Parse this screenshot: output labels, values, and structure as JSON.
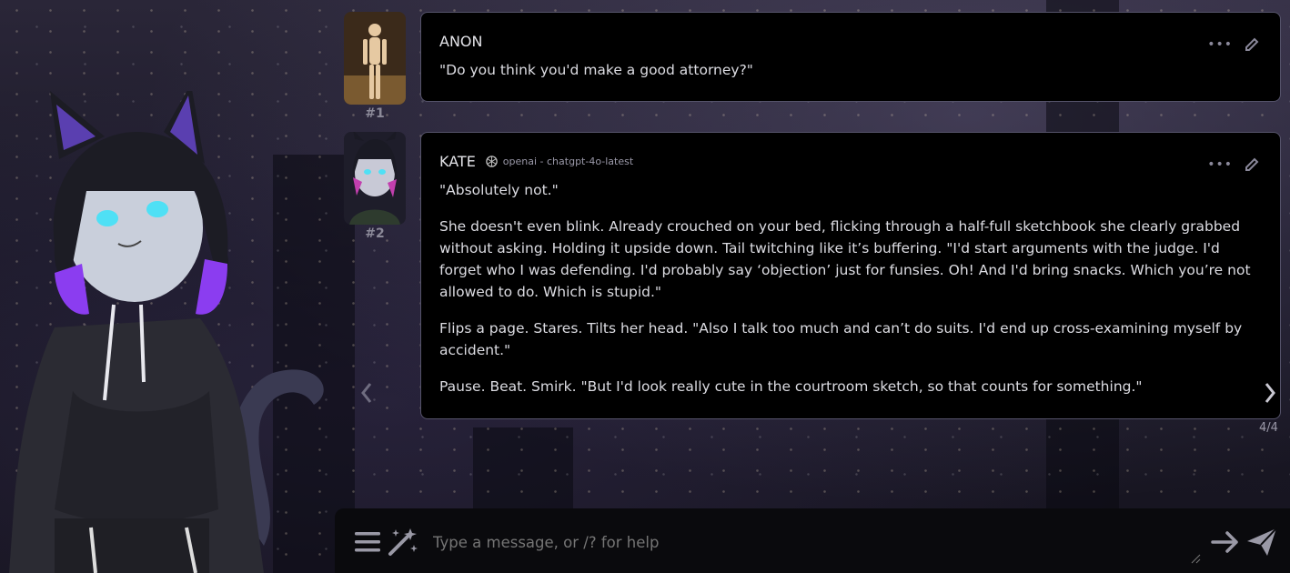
{
  "messages": [
    {
      "index_label": "#1",
      "sender": "ANON",
      "paragraphs": [
        "\"Do you think you'd make a good attorney?\""
      ]
    },
    {
      "index_label": "#2",
      "sender": "KATE",
      "model": "openai - chatgpt-4o-latest",
      "paragraphs": [
        "\"Absolutely not.\"",
        "She doesn't even blink. Already crouched on your bed, flicking through a half-full sketchbook she clearly grabbed without asking. Holding it upside down. Tail twitching like it’s buffering. \"I'd start arguments with the judge. I'd forget who I was defending. I'd probably say ‘objection’ just for funsies. Oh! And I'd bring snacks. Which you’re not allowed to do. Which is stupid.\"",
        "Flips a page. Stares. Tilts her head. \"Also I talk too much and can’t do suits. I'd end up cross-examining myself by accident.\"",
        "Pause. Beat. Smirk. \"But I'd look really cute in the courtroom sketch, so that counts for something.\""
      ],
      "swipe_counter": "4/4"
    }
  ],
  "input": {
    "placeholder": "Type a message, or /? for help"
  },
  "icons": {
    "menu": "hamburger-menu-icon",
    "magic": "magic-wand-icon",
    "more": "ellipsis-icon",
    "edit": "pencil-icon",
    "model": "openai-logo-icon",
    "continue": "arrow-right-icon",
    "send": "paper-plane-icon",
    "swipe_left": "chevron-left-icon",
    "swipe_right": "chevron-right-icon"
  },
  "colors": {
    "bubble_bg": "#000000",
    "bubble_border": "#55536a",
    "accent_purple": "#8b3df0",
    "accent_cyan": "#4fe0f5"
  }
}
